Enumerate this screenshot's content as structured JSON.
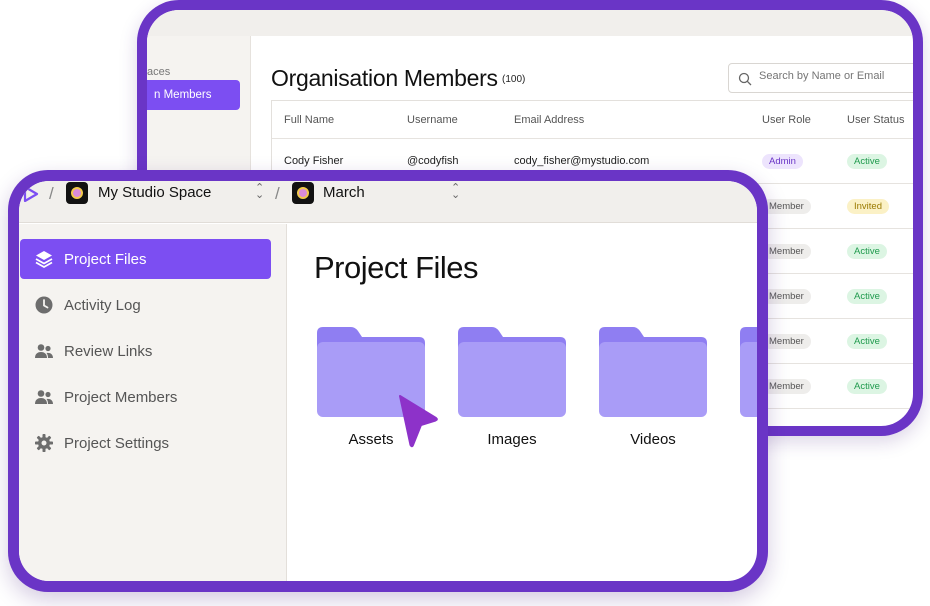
{
  "org_window": {
    "sidebar": {
      "workspaces_label": "aces",
      "selected_item": "n Members"
    },
    "title": "Organisation Members",
    "count": "(100)",
    "search": {
      "placeholder": "Search by Name or Email"
    },
    "table": {
      "headers": [
        "Full Name",
        "Username",
        "Email Address",
        "User Role",
        "User Status"
      ],
      "rows": [
        {
          "name": "Cody Fisher",
          "username": "@codyfish",
          "email": "cody_fisher@mystudio.com",
          "role": "Admin",
          "status": "Active"
        },
        {
          "name": "",
          "username": "",
          "email": "",
          "role": "Member",
          "status": "Invited"
        },
        {
          "name": "",
          "username": "",
          "email": "",
          "role": "Member",
          "status": "Active"
        },
        {
          "name": "",
          "username": "",
          "email": "",
          "role": "Member",
          "status": "Active"
        },
        {
          "name": "",
          "username": "",
          "email": "",
          "role": "Member",
          "status": "Active"
        },
        {
          "name": "",
          "username": "",
          "email": "",
          "role": "Member",
          "status": "Active"
        }
      ]
    }
  },
  "project_window": {
    "breadcrumb": {
      "workspace": "My Studio Space",
      "project": "March"
    },
    "sidebar": {
      "items": [
        {
          "label": "Project Files",
          "icon": "layers-icon",
          "active": true
        },
        {
          "label": "Activity Log",
          "icon": "clock-icon",
          "active": false
        },
        {
          "label": "Review Links",
          "icon": "users-icon",
          "active": false
        },
        {
          "label": "Project Members",
          "icon": "users-icon",
          "active": false
        },
        {
          "label": "Project Settings",
          "icon": "gear-icon",
          "active": false
        }
      ]
    },
    "title": "Project Files",
    "folders": [
      {
        "label": "Assets"
      },
      {
        "label": "Images"
      },
      {
        "label": "Videos"
      },
      {
        "label": ""
      }
    ]
  },
  "colors": {
    "accent": "#7c4ef2",
    "frame": "#6a35c6",
    "folder": "#a99cf7",
    "folder_tab": "#8f7ef2",
    "cursor": "#8d32c9"
  }
}
